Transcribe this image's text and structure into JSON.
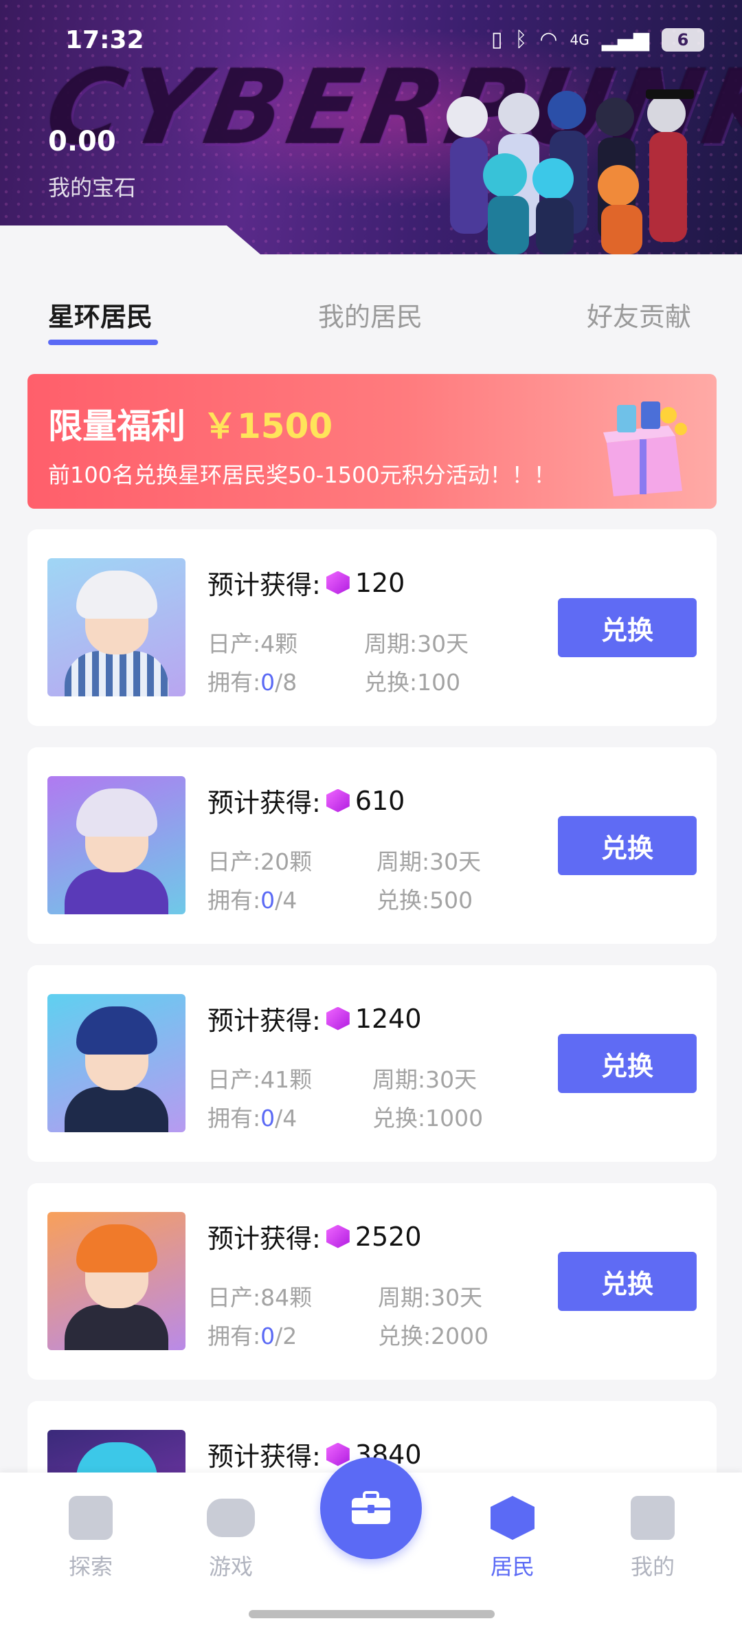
{
  "status": {
    "time": "17:32",
    "battery": "6",
    "network": "4G"
  },
  "hero": {
    "brand_text": "CYBERPUNK",
    "gem_value": "0.00",
    "gem_label": "我的宝石"
  },
  "tabs": [
    {
      "label": "星环居民",
      "active": true
    },
    {
      "label": "我的居民",
      "active": false
    },
    {
      "label": "好友贡献",
      "active": false
    }
  ],
  "promo": {
    "title": "限量福利",
    "amount": "￥1500",
    "desc": "前100名兑换星环居民奖50-1500元积分活动！！！"
  },
  "est_label": "预计获得:",
  "exchange_label": "兑换",
  "cards": [
    {
      "reward": "120",
      "daily": "日产:4颗",
      "cycle": "周期:30天",
      "own_prefix": "拥有:",
      "own": "0",
      "own_total": "/8",
      "cost": "兑换:100"
    },
    {
      "reward": "610",
      "daily": "日产:20颗",
      "cycle": "周期:30天",
      "own_prefix": "拥有:",
      "own": "0",
      "own_total": "/4",
      "cost": "兑换:500"
    },
    {
      "reward": "1240",
      "daily": "日产:41颗",
      "cycle": "周期:30天",
      "own_prefix": "拥有:",
      "own": "0",
      "own_total": "/4",
      "cost": "兑换:1000"
    },
    {
      "reward": "2520",
      "daily": "日产:84颗",
      "cycle": "周期:30天",
      "own_prefix": "拥有:",
      "own": "0",
      "own_total": "/2",
      "cost": "兑换:2000"
    },
    {
      "reward": "3840"
    }
  ],
  "nav": [
    {
      "label": "探索",
      "icon": "rocket-icon",
      "active": false
    },
    {
      "label": "游戏",
      "icon": "gamepad-icon",
      "active": false
    },
    {
      "label": "",
      "icon": "briefcase-icon",
      "active": false
    },
    {
      "label": "居民",
      "icon": "resident-icon",
      "active": true
    },
    {
      "label": "我的",
      "icon": "profile-icon",
      "active": false
    }
  ],
  "colors": {
    "accent": "#5b6af5",
    "promo_start": "#ff5f6b",
    "promo_amount": "#ffe45a",
    "gem": "#c021e8"
  }
}
